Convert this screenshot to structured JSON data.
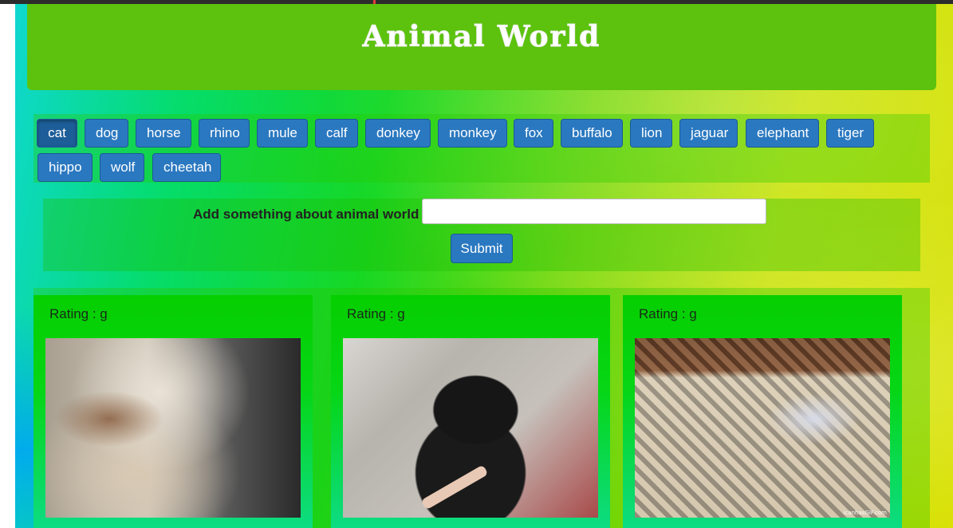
{
  "header": {
    "title": "Animal World"
  },
  "animal_buttons": [
    {
      "label": "cat",
      "active": true
    },
    {
      "label": "dog"
    },
    {
      "label": "horse"
    },
    {
      "label": "rhino"
    },
    {
      "label": "mule"
    },
    {
      "label": "calf"
    },
    {
      "label": "donkey"
    },
    {
      "label": "monkey"
    },
    {
      "label": "fox"
    },
    {
      "label": "buffalo"
    },
    {
      "label": "lion"
    },
    {
      "label": "jaguar"
    },
    {
      "label": "elephant"
    },
    {
      "label": "tiger"
    },
    {
      "label": "hippo"
    },
    {
      "label": "wolf"
    },
    {
      "label": "cheetah"
    }
  ],
  "form": {
    "label": "Add something about animal world",
    "input_value": "",
    "submit_label": "Submit"
  },
  "results": [
    {
      "rating_label": "Rating : g"
    },
    {
      "rating_label": "Rating : g"
    },
    {
      "rating_label": "Rating : g",
      "watermark": "icanhasGIF.com"
    }
  ]
}
